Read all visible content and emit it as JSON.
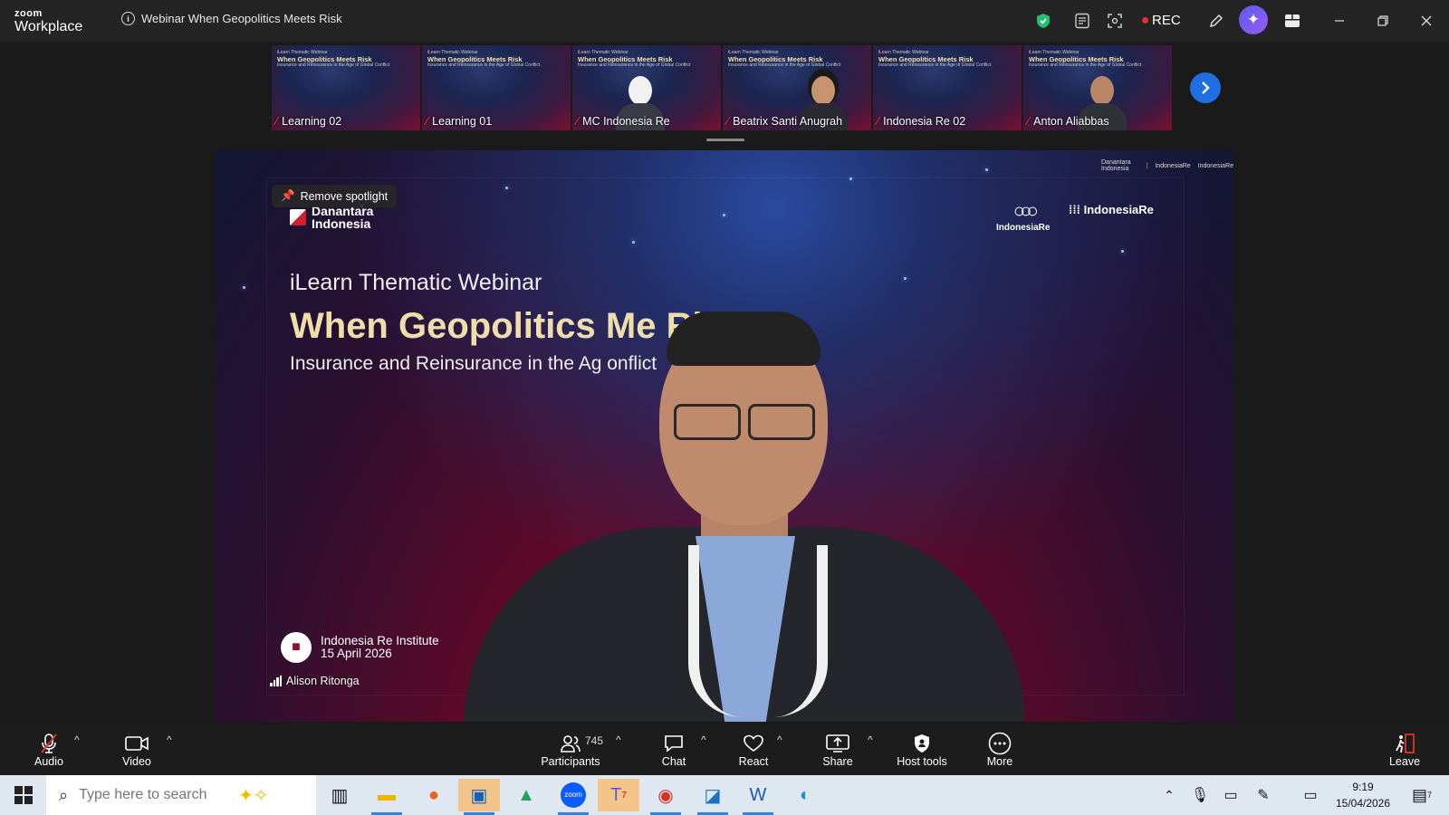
{
  "app": {
    "brand_top": "zoom",
    "brand_name": "Workplace",
    "meeting_title": "Webinar When Geopolitics Meets Risk"
  },
  "titlebar": {
    "rec_label": "REC"
  },
  "gallery": {
    "tiles": [
      {
        "label": "Learning 02",
        "mini_top": "iLearn Thematic Webinar",
        "mini_title": "When Geopolitics Meets Risk",
        "mini_sub": "Insurance and Reinsurance in the Age of Global Conflict"
      },
      {
        "label": "Learning 01",
        "mini_top": "iLearn Thematic Webinar",
        "mini_title": "When Geopolitics Meets Risk",
        "mini_sub": "Insurance and Reinsurance in the Age of Global Conflict"
      },
      {
        "label": "MC Indonesia Re",
        "mini_top": "iLearn Thematic Webinar",
        "mini_title": "When Geopolitics Meets Risk",
        "mini_sub": "Insurance and Reinsurance in the Age of Global Conflict"
      },
      {
        "label": "Beatrix Santi Anugrah",
        "mini_top": "iLearn Thematic Webinar",
        "mini_title": "When Geopolitics Meets Risk",
        "mini_sub": "Insurance and Reinsurance in the Age of Global Conflict"
      },
      {
        "label": "Indonesia Re 02",
        "mini_top": "iLearn Thematic Webinar",
        "mini_title": "When Geopolitics Meets Risk",
        "mini_sub": "Insurance and Reinsurance in the Age of Global Conflict"
      },
      {
        "label": "Anton Aliabbas",
        "mini_top": "iLearn Thematic Webinar",
        "mini_title": "When Geopolitics Meets Risk",
        "mini_sub": "Insurance and Reinsurance in the Age of Global Conflict"
      }
    ]
  },
  "main": {
    "spotlight_label": "Remove spotlight",
    "logo_left_line1": "Danantara",
    "logo_left_line2": "Indonesia",
    "logo_ire": "IndonesiaRe",
    "logo_iri": "IndonesiaRe",
    "top_logo_1": "Danantara Indonesia",
    "top_logo_2": "IndonesiaRe",
    "top_logo_3": "IndonesiaRe",
    "pretitle": "iLearn Thematic Webinar",
    "headline": "When Geopolitics Me  Risk",
    "subheadline": "Insurance and Reinsurance in the Ag        onflict",
    "watermark_line1": "Indonesia Re Institute",
    "watermark_line2": "15 April 2026",
    "speaker_name": "Alison Ritonga"
  },
  "toolbar": {
    "audio": "Audio",
    "video": "Video",
    "participants": "Participants",
    "participant_count": "745",
    "chat": "Chat",
    "react": "React",
    "share": "Share",
    "host_tools": "Host tools",
    "more": "More",
    "leave": "Leave"
  },
  "taskbar": {
    "search_placeholder": "Type here to search",
    "time": "9:19",
    "date": "15/04/2026",
    "notification_count": "7"
  },
  "colors": {
    "accent_blue": "#1f6fe0",
    "rec_red": "#e0322f",
    "headline_gold": "#f0deaa"
  }
}
